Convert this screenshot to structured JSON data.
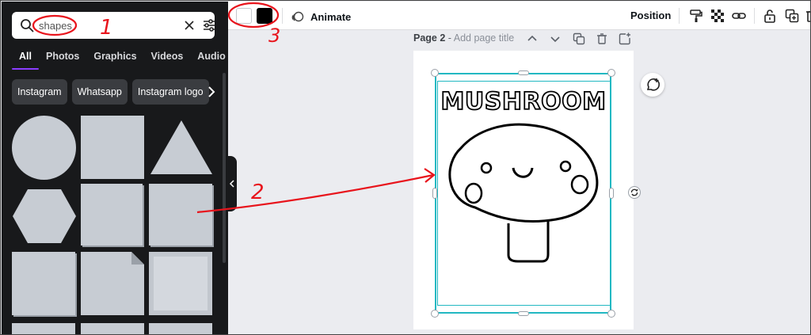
{
  "search": {
    "value": "shapes",
    "icons": {
      "search": "search-icon",
      "clear": "close-icon",
      "filter": "filter-icon"
    }
  },
  "tabs": [
    "All",
    "Photos",
    "Graphics",
    "Videos",
    "Audio"
  ],
  "chips": [
    "Instagram",
    "Whatsapp",
    "Instagram logo"
  ],
  "toolbar": {
    "animate_label": "Animate",
    "position_label": "Position",
    "swatches": [
      "#ffffff",
      "#000000"
    ],
    "icons": [
      "paint-roller-icon",
      "transparency-icon",
      "link-icon",
      "lock-icon",
      "duplicate-icon",
      "trash-icon"
    ]
  },
  "page": {
    "label": "Page 2",
    "separator": " - ",
    "title_placeholder": "Add page title"
  },
  "artwork": {
    "title": "MUSHROOM"
  },
  "annotations": {
    "step_search": "1",
    "step_drag": "2",
    "step_color": "3",
    "color": "#e8141c"
  },
  "colors": {
    "panel_bg": "#18191b",
    "accent": "#8b3dff",
    "selection": "#22b8c2",
    "shape_fill": "#c7ccd3"
  }
}
